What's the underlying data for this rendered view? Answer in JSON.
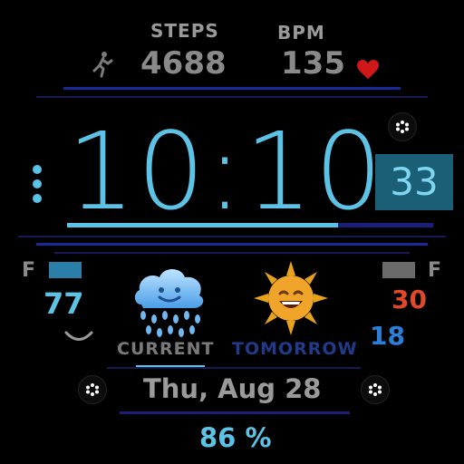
{
  "top": {
    "steps_label": "STEPS",
    "steps_value": "4688",
    "bpm_label": "BPM",
    "bpm_value": "135"
  },
  "clock": {
    "time": "10:10",
    "seconds": "33"
  },
  "weather": {
    "left_unit": "F",
    "right_unit": "F",
    "current_temp": "77",
    "current_label": "CURRENT",
    "tomorrow_label": "TOMORROW",
    "tomorrow_high": "30",
    "tomorrow_low": "18",
    "current_icon": "rain-cloud-icon",
    "tomorrow_icon": "sun-face-icon"
  },
  "date": {
    "text": "Thu, Aug 28"
  },
  "battery": {
    "text": "86 %"
  },
  "colors": {
    "accent_cyan": "#5cc3e6",
    "dark_blue": "#1a1f7a",
    "heart_red": "#d01818",
    "high_temp": "#e0482a",
    "low_temp": "#2b7fd9",
    "tomorrow_label": "#1f3b8a"
  }
}
